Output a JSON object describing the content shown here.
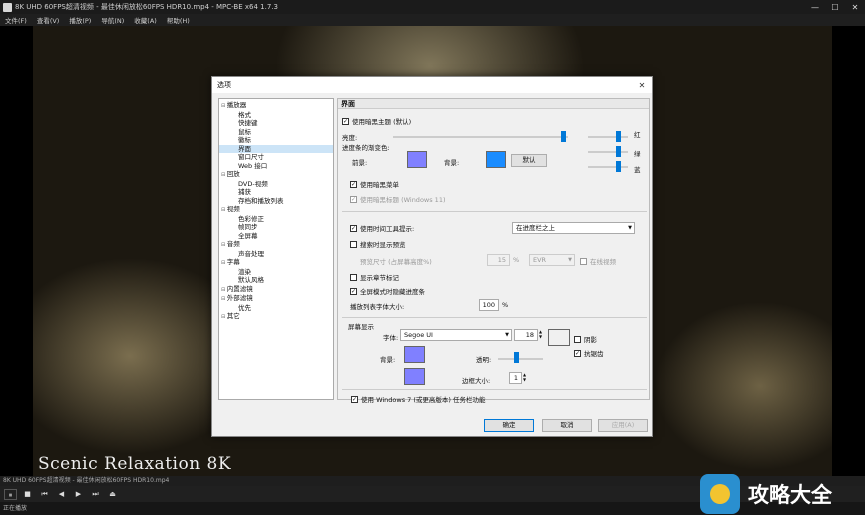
{
  "window": {
    "title": "8K UHD 60FPS超清视频 - 最佳休闲放松60FPS HDR10.mp4 - MPC-BE x64 1.7.3",
    "minimize": "—",
    "maximize": "☐",
    "close": "✕"
  },
  "menu": [
    "文件(F)",
    "查看(V)",
    "播放(P)",
    "导航(N)",
    "收藏(A)",
    "帮助(H)"
  ],
  "video": {
    "caption": "Scenic Relaxation 8K"
  },
  "seekbar": {
    "text": "8K UHD 60FPS超清视频 - 最佳休闲放松60FPS HDR10.mp4"
  },
  "controls": [
    "⏸",
    "■",
    "⏮",
    "◀",
    "▶",
    "⏭",
    "⏏"
  ],
  "statusbar": {
    "text": "正在播放"
  },
  "logo": {
    "text": "攻略大全"
  },
  "dialog": {
    "title": "选项",
    "close": "✕",
    "tree": [
      {
        "label": "播放器",
        "level": 1
      },
      {
        "label": "格式",
        "level": 2
      },
      {
        "label": "快捷键",
        "level": 2
      },
      {
        "label": "鼠标",
        "level": 2
      },
      {
        "label": "徽标",
        "level": 2
      },
      {
        "label": "界面",
        "level": 2,
        "selected": true
      },
      {
        "label": "窗口尺寸",
        "level": 2
      },
      {
        "label": "Web 接口",
        "level": 2
      },
      {
        "label": "回放",
        "level": 1
      },
      {
        "label": "DVD-视频",
        "level": 2
      },
      {
        "label": "捕获",
        "level": 2
      },
      {
        "label": "存档和播放列表",
        "level": 2
      },
      {
        "label": "视频",
        "level": 1
      },
      {
        "label": "色彩修正",
        "level": 2
      },
      {
        "label": "帧同步",
        "level": 2
      },
      {
        "label": "全屏幕",
        "level": 2
      },
      {
        "label": "音频",
        "level": 1
      },
      {
        "label": "声音处理",
        "level": 2
      },
      {
        "label": "字幕",
        "level": 1
      },
      {
        "label": "渲染",
        "level": 2
      },
      {
        "label": "默认风格",
        "level": 2
      },
      {
        "label": "内置滤镜",
        "level": 1
      },
      {
        "label": "外部滤镜",
        "level": 1
      },
      {
        "label": "优先",
        "level": 2
      },
      {
        "label": "其它",
        "level": 1
      }
    ],
    "panel": {
      "header": "界面",
      "dark_theme": {
        "label": "使用暗黑主题 (默认)",
        "checked": true
      },
      "brightness": {
        "label": "亮度:",
        "value": 0.97
      },
      "rgb": [
        {
          "label": "红",
          "value": 0.75
        },
        {
          "label": "绿",
          "value": 0.75
        },
        {
          "label": "蓝",
          "value": 0.75
        }
      ],
      "progress_color_label": "进度条的渐变色:",
      "front_label": "前景:",
      "back_label": "背景:",
      "default_button": "默认",
      "front_color": "#8080ff",
      "back_color": "#1a8cff",
      "dark_menu": {
        "label": "使用暗黑菜单",
        "checked": true
      },
      "dark_titlebar": {
        "label": "使用暗黑标题 (Windows 11)",
        "checked": true,
        "disabled": true
      },
      "show_time": {
        "label": "使用时间工具提示:",
        "checked": true
      },
      "time_position": "在进度栏之上",
      "thumbnails": {
        "label": "搜索时显示预览",
        "checked": false
      },
      "thumb_size_label": "预览尺寸 (占屏幕高度%)",
      "thumb_size_value": "15",
      "thumb_size_unit": "%",
      "thumb_renderer": "EVR",
      "thumb_online": {
        "label": "在线视频",
        "checked": false,
        "disabled": true
      },
      "chapters": {
        "label": "显示章节标记",
        "checked": false
      },
      "no_drag_label": {
        "label": "全屏模式时隐藏进度条",
        "checked": true
      },
      "playlist_font_label": "播放列表字体大小:",
      "playlist_font_value": "100",
      "playlist_font_unit": "%",
      "osd_group": "屏幕显示",
      "font_label": "字体:",
      "font_value": "Segoe UI",
      "font_size": "18",
      "shadow": {
        "label": "阴影",
        "checked": false
      },
      "antialias": {
        "label": "抗锯齿",
        "checked": true
      },
      "background_label": "背景:",
      "transparency_label": "透明:",
      "border_label": "边框大小:",
      "border_value": "1",
      "osd_bg_color": "#8080ff",
      "osd_border_color": "#8080ff",
      "win7": {
        "label": "使用 Windows 7 (或更高版本) 任务栏功能",
        "checked": true
      }
    },
    "buttons": {
      "ok": "确定",
      "cancel": "取消",
      "apply": "应用(A)"
    }
  }
}
